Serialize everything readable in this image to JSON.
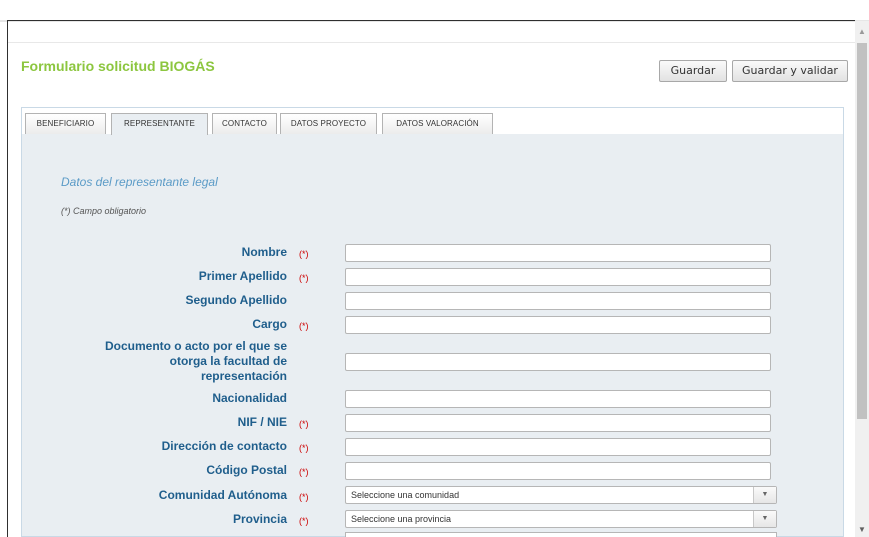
{
  "header": {
    "title": "Formulario solicitud BIOGÁS",
    "save_label": "Guardar",
    "save_validate_label": "Guardar y validar"
  },
  "tabs": [
    {
      "label": "BENEFICIARIO",
      "active": false
    },
    {
      "label": "REPRESENTANTE",
      "active": true
    },
    {
      "label": "CONTACTO",
      "active": false
    },
    {
      "label": "DATOS PROYECTO",
      "active": false
    },
    {
      "label": "DATOS VALORACIÓN",
      "active": false
    }
  ],
  "section": {
    "title": "Datos del representante legal",
    "required_note": "(*) Campo obligatorio"
  },
  "required_mark": "(*)",
  "fields": [
    {
      "label": "Nombre",
      "required": true,
      "value": ""
    },
    {
      "label": "Primer Apellido",
      "required": true,
      "value": ""
    },
    {
      "label": "Segundo Apellido",
      "required": false,
      "value": ""
    },
    {
      "label": "Cargo",
      "required": true,
      "value": ""
    },
    {
      "label": "Documento o acto por el que se otorga la facultad de representación",
      "label_lines": [
        "Documento o acto por el que se",
        "otorga la facultad de",
        "representación"
      ],
      "required": false,
      "value": ""
    },
    {
      "label": "Nacionalidad",
      "required": false,
      "value": ""
    },
    {
      "label": "NIF / NIE",
      "required": true,
      "value": ""
    },
    {
      "label": "Dirección de contacto",
      "required": true,
      "value": ""
    },
    {
      "label": "Código Postal",
      "required": true,
      "value": ""
    },
    {
      "label": "Comunidad Autónoma",
      "required": true,
      "value": "Seleccione una comunidad"
    },
    {
      "label": "Provincia",
      "required": true,
      "value": "Seleccione una provincia"
    }
  ],
  "colors": {
    "title_green": "#8cc63f",
    "label_blue": "#1f5e8c",
    "section_blue": "#5b9bc7",
    "required_red": "#cc0000",
    "panel_bg": "#e9eef2"
  },
  "icons": {
    "scroll_up": "triangle-up",
    "scroll_down": "triangle-down",
    "select_arrow": "triangle-down"
  }
}
